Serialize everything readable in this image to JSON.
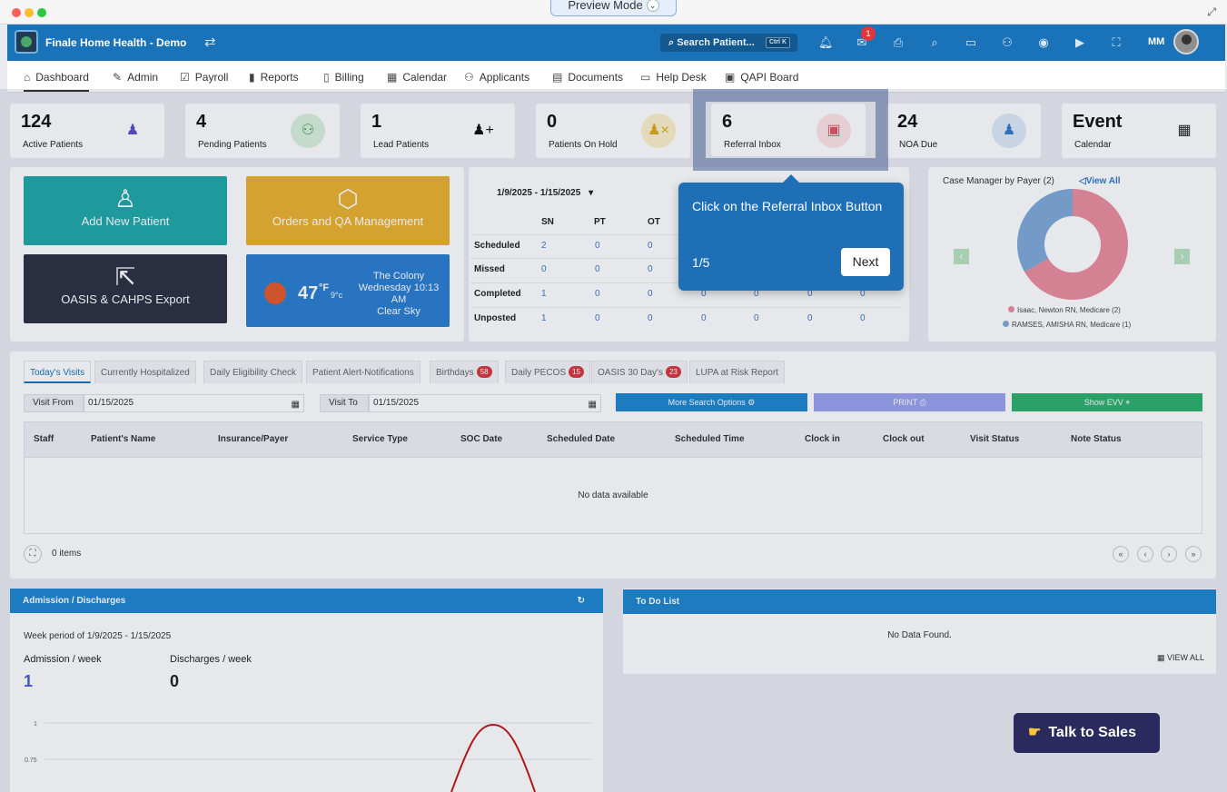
{
  "window": {
    "preview_label": "Preview Mode"
  },
  "topbar": {
    "brand": "Finale Home Health - Demo",
    "search_placeholder": "Search Patient...",
    "search_kbd": "Ctrl K",
    "mail_badge": "1",
    "user_initials": "MM"
  },
  "nav": {
    "items": [
      "Dashboard",
      "Admin",
      "Payroll",
      "Reports",
      "Billing",
      "Calendar",
      "Applicants",
      "Documents",
      "Help Desk",
      "QAPI Board"
    ]
  },
  "stats": [
    {
      "value": "124",
      "label": "Active Patients"
    },
    {
      "value": "4",
      "label": "Pending Patients"
    },
    {
      "value": "1",
      "label": "Lead Patients"
    },
    {
      "value": "0",
      "label": "Patients On Hold"
    },
    {
      "value": "6",
      "label": "Referral Inbox"
    },
    {
      "value": "24",
      "label": "NOA Due"
    },
    {
      "value": "Event",
      "label": "Calendar"
    }
  ],
  "tiles": {
    "add_patient": "Add New Patient",
    "orders": "Orders and QA Management",
    "oasis": "OASIS & CAHPS Export"
  },
  "weather": {
    "temp": "47",
    "unit_f": "°F",
    "unit_c": "9°c",
    "city": "The Colony",
    "day": "Wednesday 10:13",
    "ampm": "AM",
    "sky": "Clear Sky"
  },
  "visits": {
    "date_range": "1/9/2025 - 1/15/2025",
    "columns": [
      "SN",
      "PT",
      "OT"
    ],
    "rows": [
      {
        "label": "Scheduled",
        "values": [
          "2",
          "0",
          "0"
        ]
      },
      {
        "label": "Missed",
        "values": [
          "0",
          "0",
          "0"
        ]
      },
      {
        "label": "Completed",
        "values": [
          "1",
          "0",
          "0",
          "0",
          "0",
          "0",
          "0"
        ]
      },
      {
        "label": "Unposted",
        "values": [
          "1",
          "0",
          "0",
          "0",
          "0",
          "0",
          "0"
        ]
      }
    ]
  },
  "case_manager": {
    "title": "Case Manager by Payer",
    "count": "(2)",
    "view_all": "View All",
    "legend": [
      "Isaac, Newton RN, Medicare (2)",
      "RAMSES, AMISHA RN, Medicare (1)"
    ],
    "colors": [
      "#e98d9c",
      "#7fa9d6"
    ]
  },
  "tabs": [
    {
      "label": "Today's Visits"
    },
    {
      "label": "Currently Hospitalized"
    },
    {
      "label": "Daily Eligibility Check"
    },
    {
      "label": "Patient Alert-Notifications"
    },
    {
      "label": "Birthdays",
      "count": "58"
    },
    {
      "label": "Daily PECOS",
      "count": "15"
    },
    {
      "label": "OASIS 30 Day's",
      "count": "23"
    },
    {
      "label": "LUPA at Risk Report"
    }
  ],
  "filters": {
    "visit_from_label": "Visit From",
    "visit_from": "01/15/2025",
    "visit_to_label": "Visit To",
    "visit_to": "01/15/2025",
    "more_search": "More Search Options",
    "print": "PRINT",
    "show_evv": "Show EVV"
  },
  "table": {
    "headers": [
      "Staff",
      "Patient's Name",
      "Insurance/Payer",
      "Service Type",
      "SOC Date",
      "Scheduled Date",
      "Scheduled Time",
      "Clock in",
      "Clock out",
      "Visit Status",
      "Note Status"
    ],
    "empty": "No data available",
    "items_count": "0 items"
  },
  "admissions": {
    "title": "Admission / Discharges",
    "period": "Week period of 1/9/2025 - 1/15/2025",
    "adm_label": "Admission / week",
    "adm_value": "1",
    "dis_label": "Discharges / week",
    "dis_value": "0",
    "y_ticks": [
      "1",
      "0.75"
    ]
  },
  "todo": {
    "title": "To Do List",
    "empty": "No Data Found.",
    "view_all": "VIEW ALL"
  },
  "tour": {
    "message": "Click on the Referral Inbox Button",
    "step": "1/5",
    "next": "Next"
  },
  "sales": {
    "label": "Talk to Sales"
  },
  "chart_data": {
    "type": "pie",
    "title": "Case Manager by Payer",
    "categories": [
      "Isaac, Newton RN, Medicare (2)",
      "RAMSES, AMISHA RN, Medicare (1)"
    ],
    "values": [
      2,
      1
    ]
  }
}
